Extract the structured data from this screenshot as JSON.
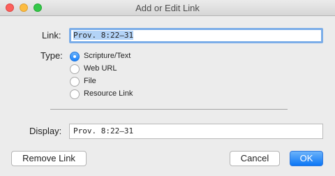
{
  "window": {
    "title": "Add or Edit Link"
  },
  "link": {
    "label": "Link:",
    "value": "Prov. 8:22–31"
  },
  "type": {
    "label": "Type:",
    "options": [
      {
        "label": "Scripture/Text",
        "selected": true
      },
      {
        "label": "Web URL",
        "selected": false
      },
      {
        "label": "File",
        "selected": false
      },
      {
        "label": "Resource Link",
        "selected": false
      }
    ]
  },
  "display": {
    "label": "Display:",
    "value": "Prov. 8:22–31"
  },
  "buttons": {
    "remove": "Remove Link",
    "cancel": "Cancel",
    "ok": "OK"
  },
  "colors": {
    "accent": "#1a82fb",
    "focus_ring": "#7bade8",
    "selection": "#b3d3f7"
  }
}
